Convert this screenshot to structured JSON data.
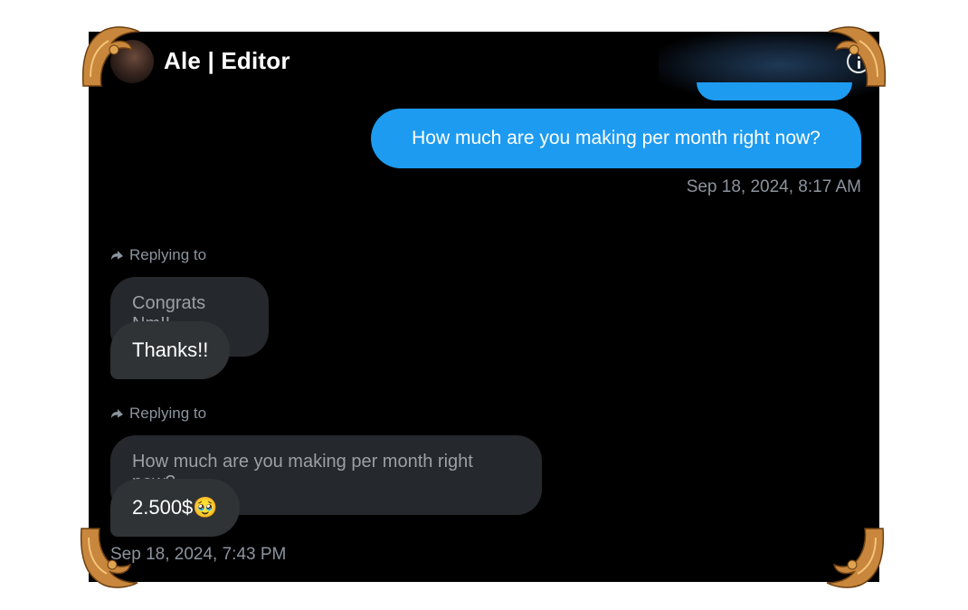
{
  "header": {
    "title": "Ale | Editor",
    "info_icon": "info-icon"
  },
  "messages": {
    "sent": {
      "text": "How much are you making per month right now?",
      "timestamp": "Sep 18, 2024, 8:17 AM"
    },
    "replies": [
      {
        "replying_label": "Replying to",
        "quoted": "Congrats Nm!!",
        "text": "Thanks!!"
      },
      {
        "replying_label": "Replying to",
        "quoted": "How much are you making per month right now?",
        "text": "2.500$🥹"
      }
    ],
    "received_timestamp": "Sep 18, 2024, 7:43 PM"
  },
  "colors": {
    "background": "#000000",
    "sent_bubble": "#1d9bf0",
    "received_bubble": "#2f3336",
    "quoted_bubble": "#25282c",
    "muted_text": "#8b949e",
    "ornament": "#c8873c"
  }
}
